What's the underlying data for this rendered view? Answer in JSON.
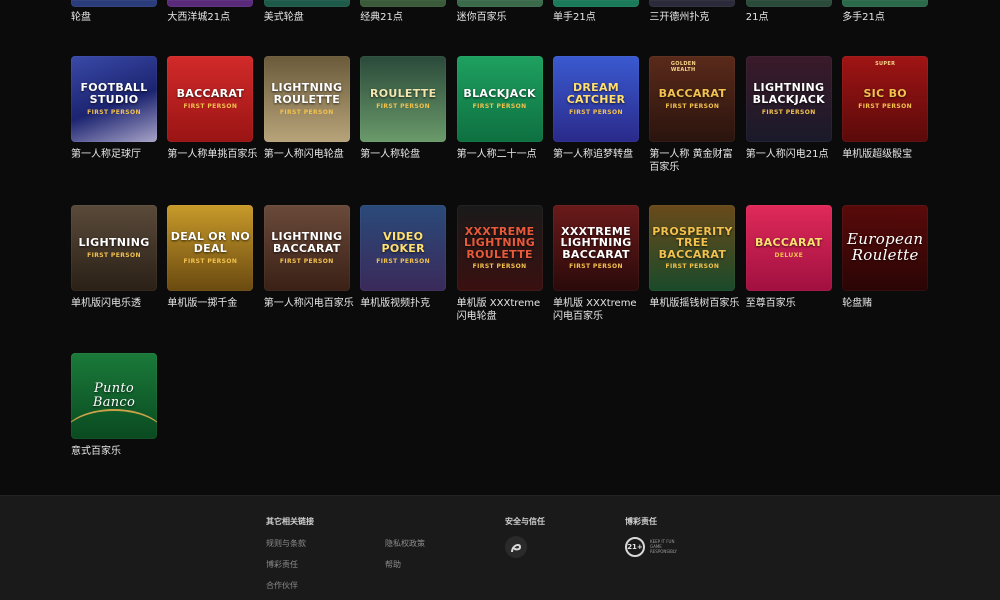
{
  "top_row": [
    {
      "label": "轮盘",
      "color": "#2a3c7a"
    },
    {
      "label": "大西洋城21点",
      "color": "#5a2a7a"
    },
    {
      "label": "美式轮盘",
      "color": "#1e5a4a"
    },
    {
      "label": "经典21点",
      "color": "#3a5a3a"
    },
    {
      "label": "迷你百家乐",
      "color": "#3a6a4a"
    },
    {
      "label": "单手21点",
      "color": "#1a7a5a"
    },
    {
      "label": "三开德州扑克",
      "color": "#2a2a3a"
    },
    {
      "label": "21点",
      "color": "#2a4a3a"
    },
    {
      "label": "多手21点",
      "color": "#2a6a4a"
    }
  ],
  "row2": [
    {
      "label": "第一人称足球厅",
      "brand": "FOOTBALL STUDIO",
      "sub": "FIRST PERSON",
      "bg": "linear-gradient(160deg,#3a4aa8,#1c2470 55%,#a8a4c8)",
      "fg": "#ffffff"
    },
    {
      "label": "第一人称单挑百家乐",
      "brand": "BACCARAT",
      "sub": "FIRST PERSON",
      "bg": "linear-gradient(180deg,#d22a2a,#9a1414)",
      "fg": "#ffffff"
    },
    {
      "label": "第一人称闪电轮盘",
      "brand": "LIGHTNING ROULETTE",
      "sub": "FIRST PERSON",
      "bg": "linear-gradient(180deg,#6a5a3a,#b8a47a)",
      "fg": "#ffffff"
    },
    {
      "label": "第一人称轮盘",
      "brand": "ROULETTE",
      "sub": "FIRST PERSON",
      "bg": "linear-gradient(180deg,#2a4a3a,#6a9a6a)",
      "fg": "#f2e6b0"
    },
    {
      "label": "第一人称二十一点",
      "brand": "BLACKJACK",
      "sub": "FIRST PERSON",
      "bg": "linear-gradient(180deg,#1ea060,#0e7040)",
      "fg": "#ffffff"
    },
    {
      "label": "第一人称追梦转盘",
      "brand": "DREAM CATCHER",
      "sub": "FIRST PERSON",
      "bg": "linear-gradient(180deg,#3a5ad0,#2a2a8a)",
      "fg": "#ffe070"
    },
    {
      "label": "第一人称 黄金财富百家乐",
      "brand": "BACCARAT",
      "sub": "FIRST PERSON",
      "badge": "GOLDEN WEALTH",
      "bg": "linear-gradient(180deg,#5a2a1a,#2a140e)",
      "fg": "#f2c14e"
    },
    {
      "label": "第一人称闪电21点",
      "brand": "LIGHTNING BLACKJACK",
      "sub": "FIRST PERSON",
      "bg": "linear-gradient(180deg,#3a1a2a,#1a1a2a)",
      "fg": "#ffffff"
    },
    {
      "label": "单机版超级骰宝",
      "brand": "SIC BO",
      "sub": "FIRST PERSON",
      "badge": "SUPER",
      "bg": "linear-gradient(180deg,#a01414,#5a0a0a)",
      "fg": "#f2c14e"
    }
  ],
  "row3": [
    {
      "label": "单机版闪电乐透",
      "brand": "LIGHTNING",
      "sub": "FIRST PERSON",
      "bg": "linear-gradient(180deg,#5a4a3a,#2a2016)",
      "fg": "#ffffff"
    },
    {
      "label": "单机版一掷千金",
      "brand": "DEAL OR NO DEAL",
      "sub": "FIRST PERSON",
      "bg": "linear-gradient(180deg,#c89a2a,#6a4a10)",
      "fg": "#ffffff"
    },
    {
      "label": "第一人称闪电百家乐",
      "brand": "LIGHTNING BACCARAT",
      "sub": "FIRST PERSON",
      "bg": "linear-gradient(180deg,#6a4a3a,#3a2016)",
      "fg": "#ffffff"
    },
    {
      "label": "单机版视频扑克",
      "brand": "VIDEO POKER",
      "sub": "FIRST PERSON",
      "bg": "linear-gradient(180deg,#2a4a7a,#3a2a5a)",
      "fg": "#ffe070"
    },
    {
      "label": "单机版 XXXtreme 闪电轮盘",
      "brand": "XXXTREME LIGHTNING ROULETTE",
      "sub": "FIRST PERSON",
      "bg": "linear-gradient(180deg,#1a1a1a,#3a1010)",
      "fg": "#e85a3a"
    },
    {
      "label": "单机版 XXXtreme 闪电百家乐",
      "brand": "XXXTREME LIGHTNING BACCARAT",
      "sub": "FIRST PERSON",
      "bg": "linear-gradient(180deg,#6a1a1a,#2a0a0a)",
      "fg": "#ffffff"
    },
    {
      "label": "单机版摇钱树百家乐",
      "brand": "PROSPERITY TREE BACCARAT",
      "sub": "FIRST PERSON",
      "bg": "linear-gradient(180deg,#6a4a1a,#1a4a2a)",
      "fg": "#f2c14e"
    },
    {
      "label": "至尊百家乐",
      "brand": "BACCARAT",
      "sub": "DELUXE",
      "bg": "linear-gradient(180deg,#e02a5a,#a01040)",
      "fg": "#ffe070"
    },
    {
      "label": "轮盘赌",
      "brand": "European Roulette",
      "sub": "",
      "bg": "linear-gradient(180deg,#5a0a0a,#2a0505)",
      "fg": "#ffffff"
    }
  ],
  "row4": [
    {
      "label": "意式百家乐",
      "brand": "Punto Banco",
      "sub": "",
      "bg": "linear-gradient(180deg,#1a7a3a,#0a4a20)",
      "fg": "#ffffff"
    }
  ],
  "footer": {
    "col1_title": "其它相关链接",
    "links_a": [
      "规则与条款",
      "博彩责任",
      "合作伙伴"
    ],
    "links_b": [
      "隐私权政策",
      "帮助"
    ],
    "col2_title": "安全与信任",
    "col3_title": "博彩责任",
    "badge_21": "21+",
    "badge_text": "KEEP IT FUN GAME RESPONSIBLY"
  }
}
